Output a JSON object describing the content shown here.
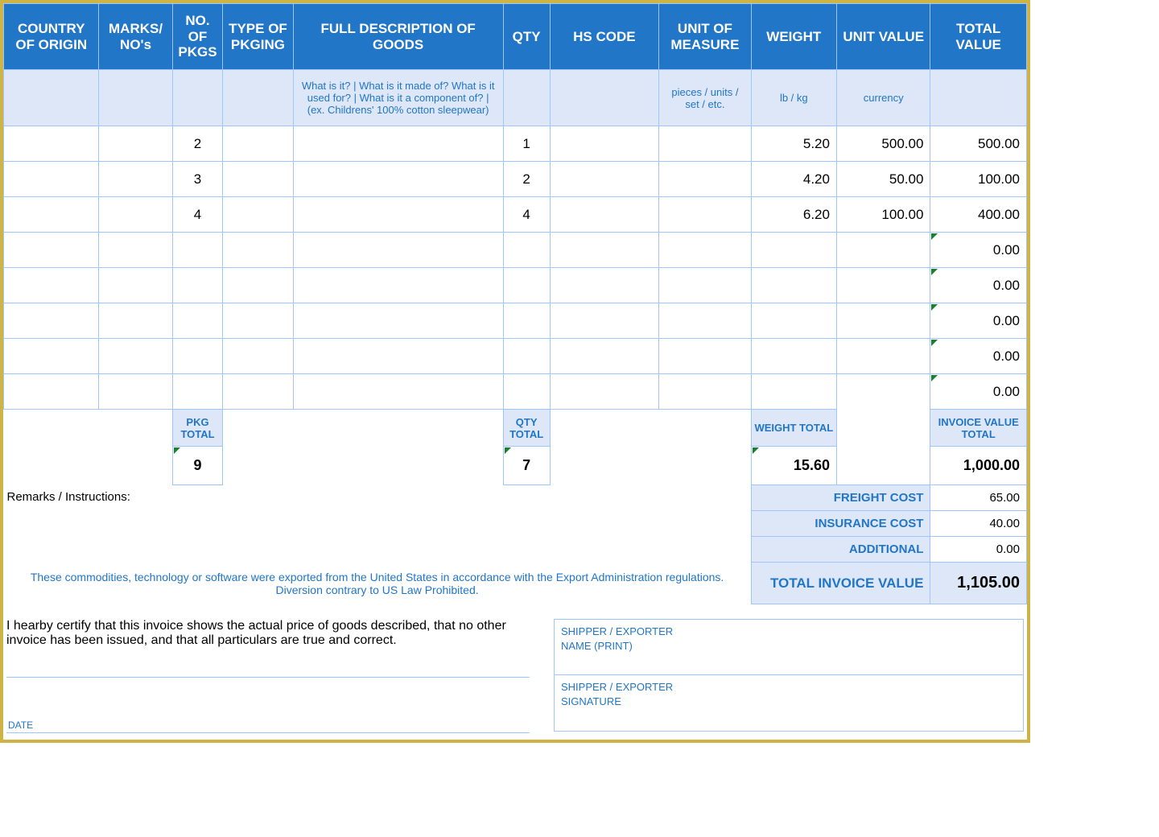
{
  "headers": [
    "COUNTRY OF ORIGIN",
    "MARKS/ NO's",
    "NO. OF PKGS",
    "TYPE OF PKGING",
    "FULL DESCRIPTION OF GOODS",
    "QTY",
    "HS CODE",
    "UNIT OF MEASURE",
    "WEIGHT",
    "UNIT VALUE",
    "TOTAL VALUE"
  ],
  "hints": {
    "desc": "What is it? | What is it made of? What is it used for? | What is it a component of? | (ex. Childrens' 100% cotton sleepwear)",
    "uom": "pieces / units / set / etc.",
    "weight": "lb / kg",
    "unitval": "currency"
  },
  "rows": [
    {
      "pkgs": "2",
      "qty": "1",
      "weight": "5.20",
      "unit": "500.00",
      "total": "500.00"
    },
    {
      "pkgs": "3",
      "qty": "2",
      "weight": "4.20",
      "unit": "50.00",
      "total": "100.00"
    },
    {
      "pkgs": "4",
      "qty": "4",
      "weight": "6.20",
      "unit": "100.00",
      "total": "400.00"
    },
    {
      "pkgs": "",
      "qty": "",
      "weight": "",
      "unit": "",
      "total": "0.00",
      "tri": true
    },
    {
      "pkgs": "",
      "qty": "",
      "weight": "",
      "unit": "",
      "total": "0.00",
      "tri": true
    },
    {
      "pkgs": "",
      "qty": "",
      "weight": "",
      "unit": "",
      "total": "0.00",
      "tri": true
    },
    {
      "pkgs": "",
      "qty": "",
      "weight": "",
      "unit": "",
      "total": "0.00",
      "tri": true
    },
    {
      "pkgs": "",
      "qty": "",
      "weight": "",
      "unit": "",
      "total": "0.00",
      "tri": true
    }
  ],
  "totals_labels": {
    "pkg": "PKG TOTAL",
    "qty": "QTY TOTAL",
    "weight": "WEIGHT TOTAL",
    "invoice": "INVOICE VALUE TOTAL"
  },
  "totals": {
    "pkg": "9",
    "qty": "7",
    "weight": "15.60",
    "invoice": "1,000.00"
  },
  "remarks_label": "Remarks / Instructions:",
  "costs": {
    "freight_lbl": "FREIGHT COST",
    "freight": "65.00",
    "insurance_lbl": "INSURANCE COST",
    "insurance": "40.00",
    "additional_lbl": "ADDITIONAL",
    "additional": "0.00",
    "totinv_lbl": "TOTAL INVOICE VALUE",
    "totinv": "1,105.00"
  },
  "export_text": "These commodities, technology or software were exported from the United States in accordance with the Export Administration regulations.  Diversion contrary to US Law Prohibited.",
  "cert_text": "I hearby certify that this invoice shows the actual price of goods described, that no other invoice has been issued, and that all particulars are true and correct.",
  "sig": {
    "date": "DATE",
    "ship_name": "SHIPPER / EXPORTER\nNAME (PRINT)",
    "ship_sig": "SHIPPER / EXPORTER\nSIGNATURE"
  }
}
